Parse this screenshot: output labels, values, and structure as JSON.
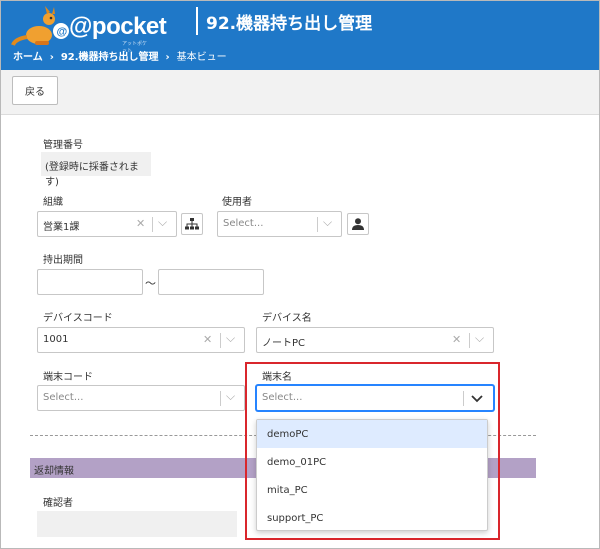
{
  "app": {
    "logo_text": "@pocket",
    "logo_sub": "アットポケット",
    "title": "92.機器持ち出し管理"
  },
  "breadcrumb": [
    "ホーム",
    "92.機器持ち出し管理",
    "基本ビュー"
  ],
  "toolbar": {
    "back_label": "戻る"
  },
  "form": {
    "management_no": {
      "label": "管理番号",
      "value": "(登録時に採番されます)"
    },
    "organization": {
      "label": "組織",
      "value": "営業1課"
    },
    "user": {
      "label": "使用者",
      "placeholder": "Select..."
    },
    "period": {
      "label": "持出期間",
      "separator": "～"
    },
    "device_code": {
      "label": "デバイスコード",
      "value": "1001"
    },
    "device_name": {
      "label": "デバイス名",
      "value": "ノートPC"
    },
    "terminal_code": {
      "label": "端末コード",
      "placeholder": "Select..."
    },
    "terminal_name": {
      "label": "端末名",
      "placeholder": "Select...",
      "options": [
        "demoPC",
        "demo_01PC",
        "mita_PC",
        "support_PC"
      ],
      "highlighted_option": "demoPC"
    },
    "return_section": {
      "title": "返却情報"
    },
    "confirmer": {
      "label": "確認者"
    }
  },
  "colors": {
    "header": "#1f78c8",
    "section": "#b3a1c6",
    "highlight_box": "#d9262c",
    "focus": "#2684ff",
    "option_selected": "#deebff"
  },
  "icons": {
    "org_tree": "org-tree-icon",
    "person": "person-icon",
    "clear": "clear-x-icon",
    "chevron": "chevron-down-icon"
  }
}
